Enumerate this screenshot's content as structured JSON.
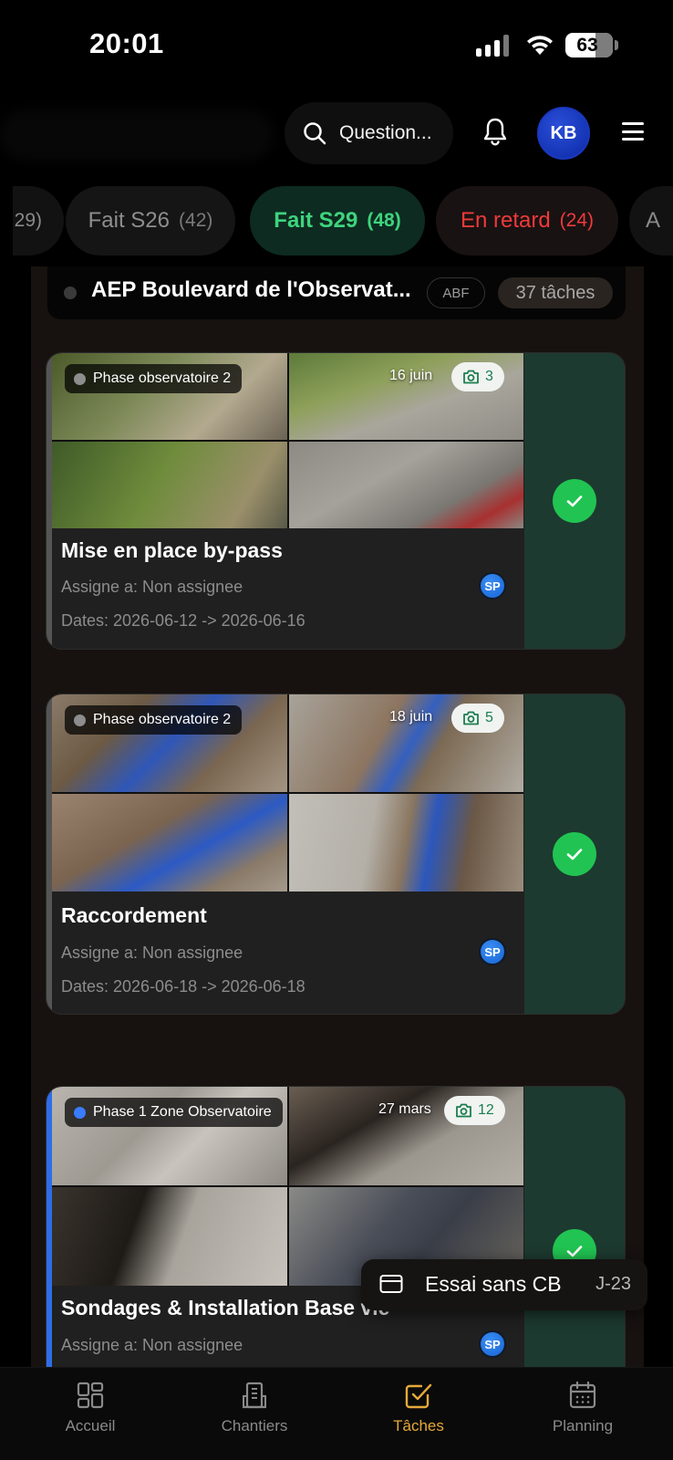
{
  "status_bar": {
    "time": "20:01",
    "battery": "63"
  },
  "header": {
    "search_label": "Question...",
    "avatar_initials": "KB"
  },
  "filters": [
    {
      "label": "",
      "count": "29)"
    },
    {
      "label": "Fait S26",
      "count": "(42)"
    },
    {
      "label": "Fait S29",
      "count": "(48)"
    },
    {
      "label": "En retard",
      "count": "(24)"
    },
    {
      "label": "A",
      "count": ""
    }
  ],
  "project": {
    "name": "AEP Boulevard de l'Observat...",
    "tag": "ABF",
    "task_count": "37 tâches"
  },
  "tasks": [
    {
      "phase": "Phase observatoire 2",
      "date": "16 juin",
      "photo_count": "3",
      "title": "Mise en place by-pass",
      "assigned": "Assigne a: Non assignee",
      "dates": "Dates: 2026-06-12 -> 2026-06-16",
      "assignee_initials": "SP"
    },
    {
      "phase": "Phase observatoire 2",
      "date": "18 juin",
      "photo_count": "5",
      "title": "Raccordement",
      "assigned": "Assigne a: Non assignee",
      "dates": "Dates: 2026-06-18 -> 2026-06-18",
      "assignee_initials": "SP"
    },
    {
      "phase": "Phase 1 Zone Observatoire",
      "date": "27 mars",
      "photo_count": "12",
      "title": "Sondages & Installation Base vie",
      "assigned": "Assigne a: Non assignee",
      "assignee_initials": "SP"
    }
  ],
  "toast": {
    "text": "Essai sans CB",
    "days": "J-23"
  },
  "tabbar": [
    {
      "label": "Accueil",
      "icon": "dashboard-icon"
    },
    {
      "label": "Chantiers",
      "icon": "building-icon"
    },
    {
      "label": "Tâches",
      "icon": "task-check-icon",
      "active": true
    },
    {
      "label": "Planning",
      "icon": "calendar-icon"
    }
  ],
  "colors": {
    "accent_green": "#3fd37e",
    "late_red": "#ef3a3a",
    "active_tab": "#e7a93a",
    "done_panel": "#1d3a30",
    "check_green": "#21c452"
  }
}
